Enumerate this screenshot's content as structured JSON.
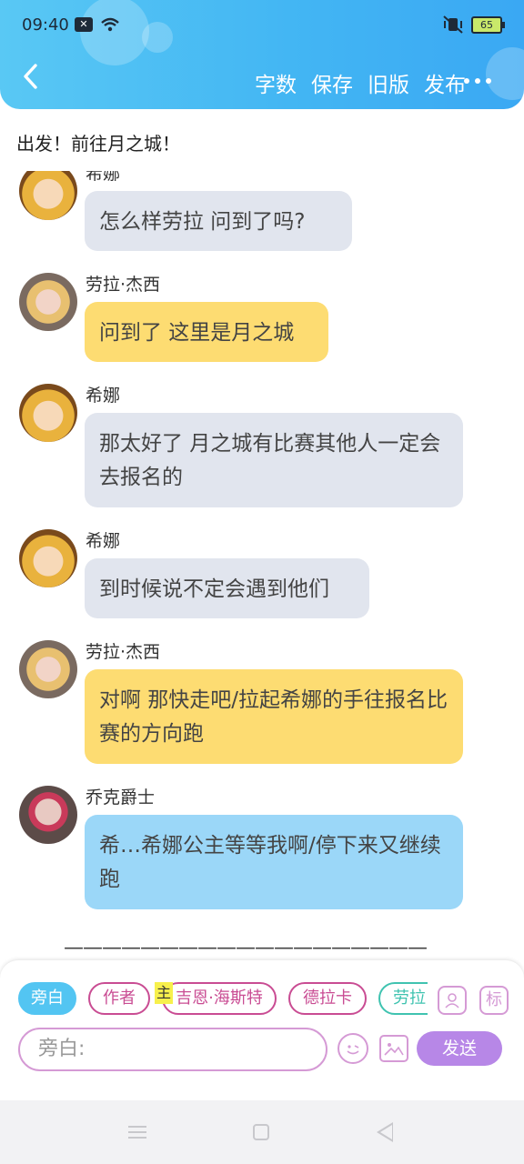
{
  "status": {
    "time": "09:40",
    "battery": "65",
    "notice_icon": "notification-icon",
    "wifi_icon": "wifi-icon",
    "mute_icon": "vibrate-mute-icon"
  },
  "header": {
    "back_icon": "back-chevron-icon",
    "actions": [
      "字数",
      "保存",
      "旧版",
      "发布"
    ],
    "more_icon": "more-dots-icon"
  },
  "story": {
    "title": "出发！前往月之城！"
  },
  "messages": [
    {
      "speaker": "希娜",
      "avatar": "xina",
      "style": "gray",
      "text": "怎么样劳拉 问到了吗?"
    },
    {
      "speaker": "劳拉·杰西",
      "avatar": "laura",
      "style": "yellow",
      "text": "问到了 这里是月之城"
    },
    {
      "speaker": "希娜",
      "avatar": "xina",
      "style": "gray",
      "text": "那太好了 月之城有比赛其他人一定会去报名的"
    },
    {
      "speaker": "希娜",
      "avatar": "xina",
      "style": "gray",
      "text": "到时候说不定会遇到他们"
    },
    {
      "speaker": "劳拉·杰西",
      "avatar": "laura",
      "style": "yellow",
      "text": "对啊 那快走吧/拉起希娜的手往报名比赛的方向跑"
    },
    {
      "speaker": "乔克爵士",
      "avatar": "joker",
      "style": "blue",
      "text": "希…希娜公主等等我啊/停下来又继续跑"
    }
  ],
  "divider": "———————————————————",
  "composer": {
    "chips": [
      "旁白",
      "作者",
      "吉恩·海斯特",
      "德拉卡",
      "劳拉"
    ],
    "active_chip": "旁白",
    "main_tag": "主",
    "role_icon": "person-card-icon",
    "tag_icon_label": "标",
    "input_placeholder": "旁白:",
    "emoji_icon": "emoji-icon",
    "image_icon": "image-icon",
    "send_label": "发送"
  },
  "system_nav": {
    "menu_icon": "menu-icon",
    "home_icon": "home-icon",
    "back_icon": "back-triangle-icon"
  },
  "colors": {
    "header_gradient_start": "#59c8f4",
    "header_gradient_end": "#3aa8f3",
    "bubble_gray": "#e1e5ee",
    "bubble_yellow": "#fddc72",
    "bubble_blue": "#9bd7f8",
    "accent_pink": "#c94c93",
    "send_purple": "#b787e7"
  }
}
